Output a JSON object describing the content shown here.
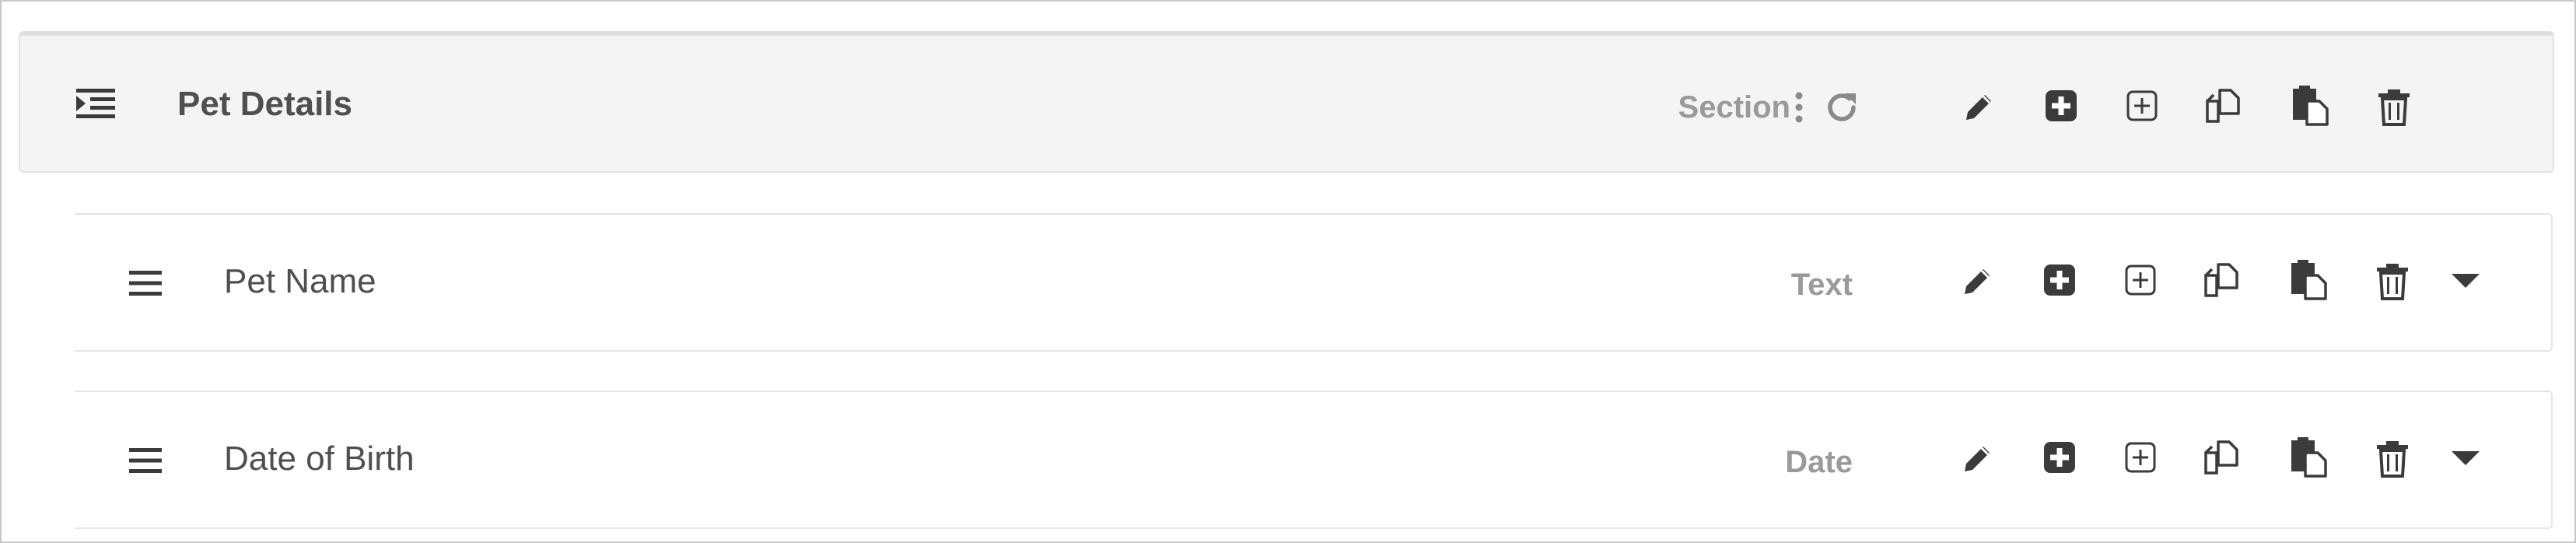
{
  "section": {
    "title": "Pet Details",
    "type": "Section",
    "icons": {
      "handle": "indent-icon",
      "more": "vertical-dots-icon",
      "refresh": "refresh-icon"
    }
  },
  "fields": [
    {
      "title": "Pet Name",
      "type": "Text"
    },
    {
      "title": "Date of Birth",
      "type": "Date"
    }
  ],
  "row_actions": [
    {
      "name": "edit",
      "icon": "pencil-icon"
    },
    {
      "name": "add-solid",
      "icon": "plus-square-solid-icon"
    },
    {
      "name": "add-outline",
      "icon": "plus-square-outline-icon"
    },
    {
      "name": "duplicate",
      "icon": "copy-icon"
    },
    {
      "name": "paste",
      "icon": "paste-icon"
    },
    {
      "name": "delete",
      "icon": "trash-icon"
    },
    {
      "name": "expand",
      "icon": "caret-down-icon"
    }
  ],
  "colors": {
    "icon": "#3b3b3b",
    "muted": "#9a9a9a",
    "section_bg": "#f4f4f5"
  }
}
